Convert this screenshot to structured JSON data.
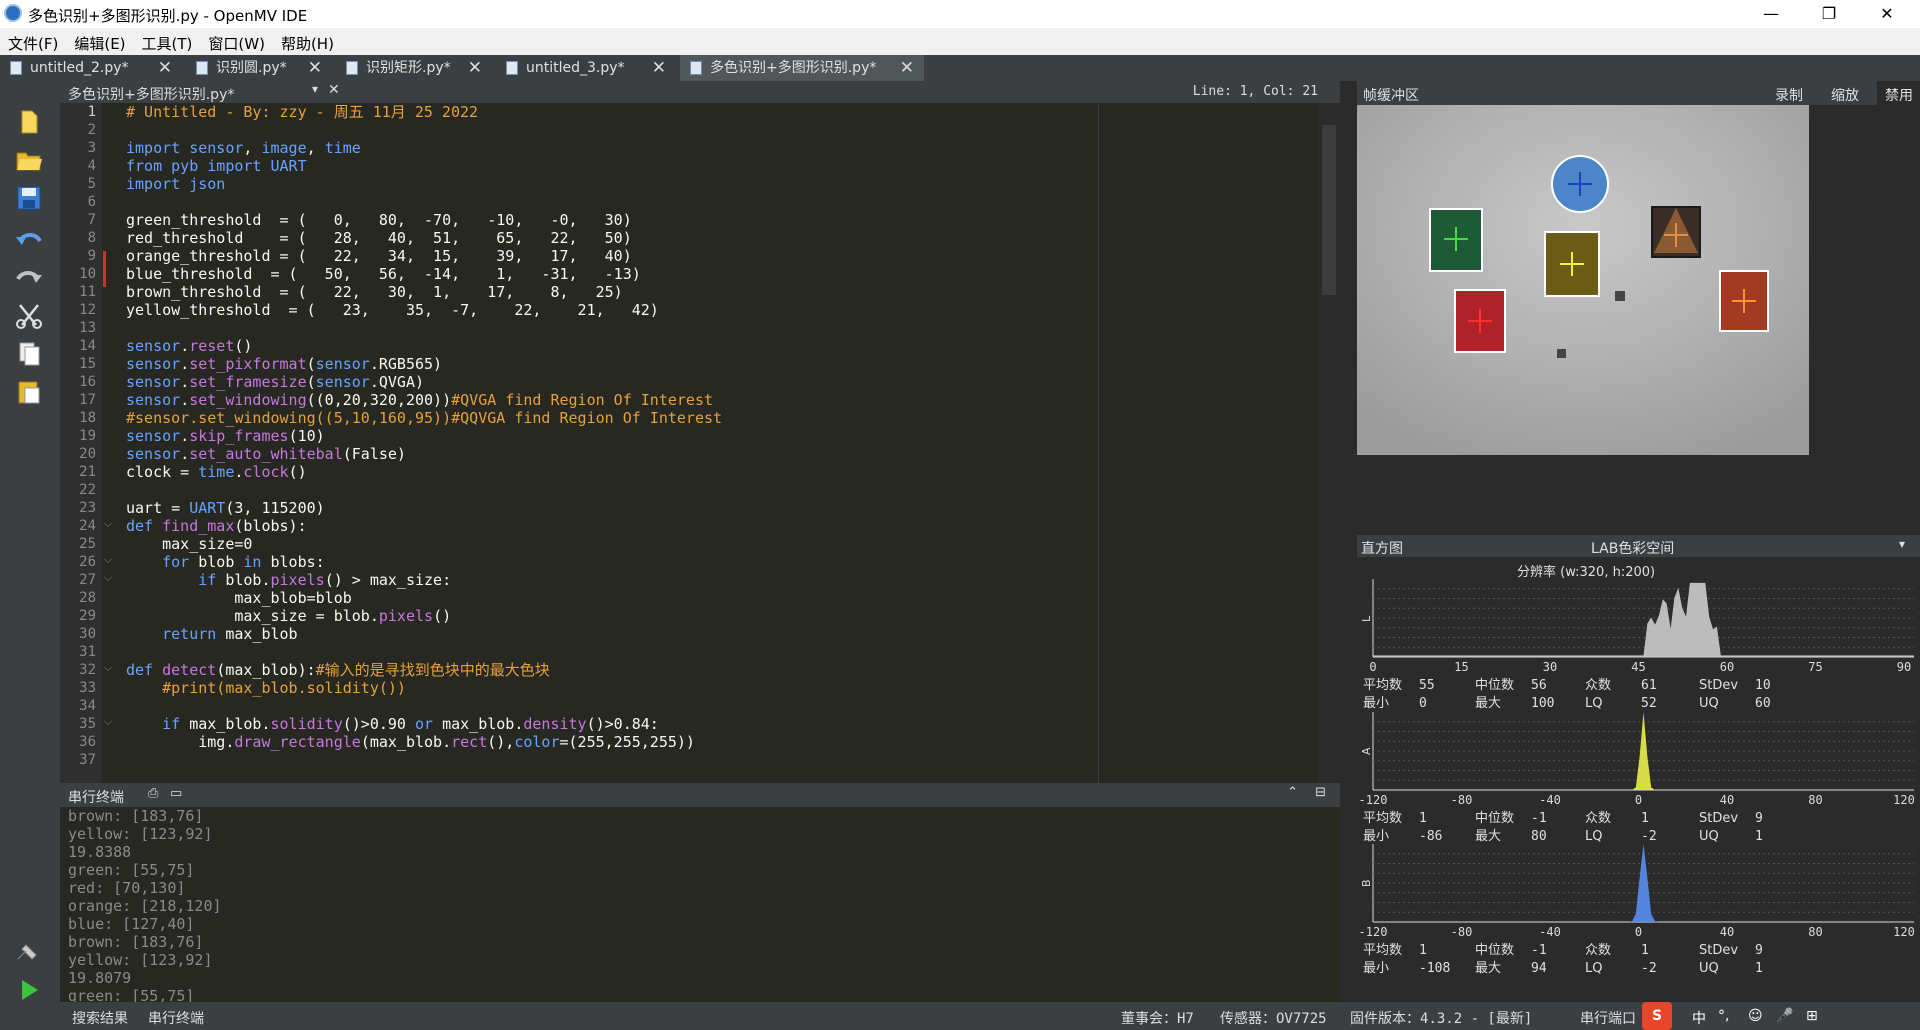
{
  "window": {
    "title": "多色识别+多图形识别.py - OpenMV IDE",
    "min": "—",
    "max": "❐",
    "close": "✕"
  },
  "menu": [
    "文件(F)",
    "编辑(E)",
    "工具(T)",
    "窗口(W)",
    "帮助(H)"
  ],
  "tabs": [
    {
      "label": "untitled_2.py*",
      "active": false
    },
    {
      "label": "识别圆.py*",
      "active": false
    },
    {
      "label": "识别矩形.py*",
      "active": false
    },
    {
      "label": "untitled_3.py*",
      "active": false
    },
    {
      "label": "多色识别+多图形识别.py*",
      "active": true
    }
  ],
  "tab_close": "✕",
  "editor": {
    "file_name": "多色识别+多图形识别.py*",
    "cursor": "Line: 1, Col: 21",
    "line_numbers": [
      "1",
      "2",
      "3",
      "4",
      "5",
      "6",
      "7",
      "8",
      "9",
      "10",
      "11",
      "12",
      "13",
      "14",
      "15",
      "16",
      "17",
      "18",
      "19",
      "20",
      "21",
      "22",
      "23",
      "24",
      "25",
      "26",
      "27",
      "28",
      "29",
      "30",
      "31",
      "32",
      "33",
      "34",
      "35",
      "36",
      "37"
    ],
    "code": [
      "# Untitled - By: zzy - 周五 11月 25 2022",
      "",
      "import sensor, image, time",
      "from pyb import UART",
      "import json",
      "",
      "green_threshold  = (   0,   80,  -70,   -10,   -0,   30)",
      "red_threshold    = (   28,   40,  51,    65,   22,   50)",
      "orange_threshold = (   22,   34,  15,    39,   17,   40)",
      "blue_threshold  = (   50,   56,  -14,    1,   -31,   -13)",
      "brown_threshold  = (   22,   30,  1,    17,    8,   25)",
      "yellow_threshold  = (   23,    35,  -7,    22,    21,   42)",
      "",
      "sensor.reset()",
      "sensor.set_pixformat(sensor.RGB565)",
      "sensor.set_framesize(sensor.QVGA)",
      "sensor.set_windowing((0,20,320,200))#QVGA find Region Of Interest",
      "#sensor.set_windowing((5,10,160,95))#QQVGA find Region Of Interest",
      "sensor.skip_frames(10)",
      "sensor.set_auto_whitebal(False)",
      "clock = time.clock()",
      "",
      "uart = UART(3, 115200)",
      "def find_max(blobs):",
      "    max_size=0",
      "    for blob in blobs:",
      "        if blob.pixels() > max_size:",
      "            max_blob=blob",
      "            max_size = blob.pixels()",
      "    return max_blob",
      "",
      "def detect(max_blob):#输入的是寻找到色块中的最大色块",
      "    #print(max_blob.solidity())",
      "",
      "    if max_blob.solidity()>0.90 or max_blob.density()>0.84:",
      "        img.draw_rectangle(max_blob.rect(),color=(255,255,255))",
      ""
    ]
  },
  "serial": {
    "title": "串行终端",
    "lines": [
      "brown: [183,76]",
      "yellow: [123,92]",
      "19.8388",
      "green: [55,75]",
      "red: [70,130]",
      "orange: [218,120]",
      "blue: [127,40]",
      "brown: [183,76]",
      "yellow: [123,92]",
      "19.8079",
      "green: [55,75]"
    ]
  },
  "bottom": {
    "search": "搜索结果",
    "serial": "串行终端",
    "board": "董事会：H7",
    "sensor": "传感器：OV7725",
    "firmware": "固件版本：4.3.2 - [最新]",
    "port": "串行端口",
    "ime": [
      "中",
      "°,",
      "☺",
      "🎤",
      "⊞"
    ]
  },
  "framebuffer": {
    "title": "帧缓冲区",
    "record": "录制",
    "zoom": "缩放",
    "disable": "禁用"
  },
  "histogram": {
    "title": "直方图",
    "colorspace": "LAB色彩空间",
    "resolution": "分辨率 (w:320, h:200)",
    "channels": [
      {
        "name": "L",
        "ticks": [
          "0",
          "15",
          "30",
          "45",
          "60",
          "75",
          "90"
        ],
        "mean": "55",
        "median": "56",
        "mode": "61",
        "stdev": "10",
        "min": "0",
        "max": "100",
        "lq": "52",
        "uq": "60"
      },
      {
        "name": "A",
        "ticks": [
          "-120",
          "-80",
          "-40",
          "0",
          "40",
          "80",
          "120"
        ],
        "mean": "1",
        "median": "-1",
        "mode": "1",
        "stdev": "9",
        "min": "-86",
        "max": "80",
        "lq": "-2",
        "uq": "1"
      },
      {
        "name": "B",
        "ticks": [
          "-120",
          "-80",
          "-40",
          "0",
          "40",
          "80",
          "120"
        ],
        "mean": "1",
        "median": "-1",
        "mode": "1",
        "stdev": "9",
        "min": "-108",
        "max": "94",
        "lq": "-2",
        "uq": "1"
      }
    ],
    "labels": {
      "mean": "平均数",
      "median": "中位数",
      "mode": "众数",
      "stdev": "StDev",
      "min": "最小",
      "max": "最大",
      "lq": "LQ",
      "uq": "UQ"
    }
  }
}
